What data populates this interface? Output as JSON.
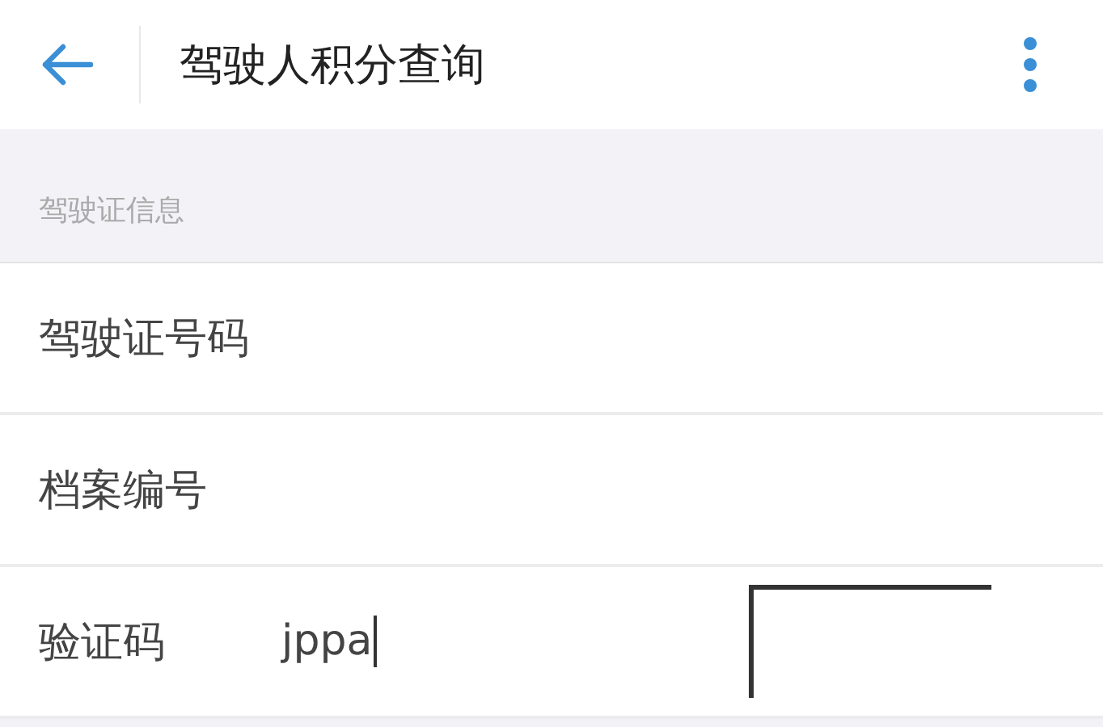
{
  "app_bar": {
    "title": "驾驶人积分查询"
  },
  "section": {
    "title": "驾驶证信息"
  },
  "fields": [
    {
      "kind": "text",
      "label": "驾驶证号码"
    },
    {
      "kind": "text",
      "label": "档案编号"
    },
    {
      "kind": "captcha",
      "label": "验证码",
      "value": "jppa",
      "focused": true
    }
  ]
}
